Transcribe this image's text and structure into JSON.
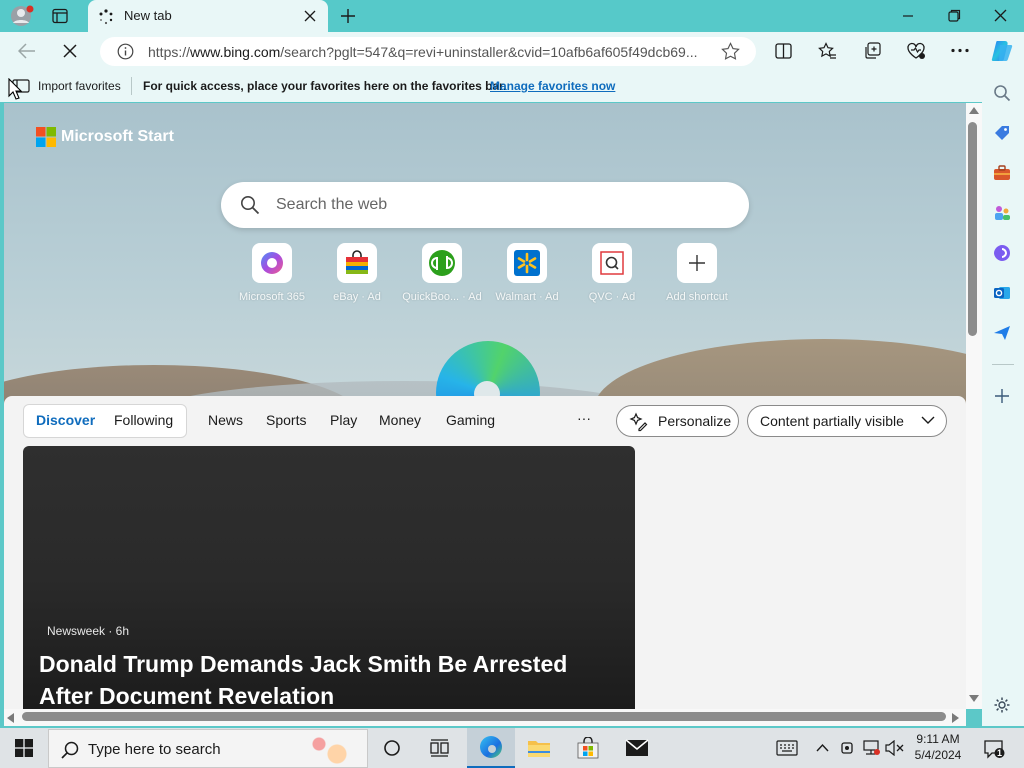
{
  "browser": {
    "tab_title": "New tab",
    "url_prefix": "https://",
    "url_host": "www.bing.com",
    "url_rest": "/search?pglt=547&q=revi+uninstaller&cvid=10afb6af605f49dcb69...",
    "favorites_bar": {
      "import_label": "Import favorites",
      "hint": "For quick access, place your favorites here on the favorites bar.",
      "manage_link": "Manage favorites now"
    }
  },
  "page": {
    "brand": "Microsoft Start",
    "search_placeholder": "Search the web",
    "shortcuts": [
      {
        "label": "Microsoft 365"
      },
      {
        "label": "eBay · Ad"
      },
      {
        "label": "QuickBoo... · Ad"
      },
      {
        "label": "Walmart · Ad"
      },
      {
        "label": "QVC · Ad"
      },
      {
        "label": "Add shortcut"
      }
    ],
    "pivots": {
      "discover": "Discover",
      "following": "Following",
      "news": "News",
      "sports": "Sports",
      "play": "Play",
      "money": "Money",
      "gaming": "Gaming",
      "more": "···"
    },
    "personalize_label": "Personalize",
    "content_visibility": "Content partially visible",
    "card": {
      "source": "Newsweek · 6h",
      "headline": "Donald Trump Demands Jack Smith Be Arrested After Document Revelation"
    }
  },
  "taskbar": {
    "search_placeholder": "Type here to search",
    "time": "9:11 AM",
    "date": "5/4/2024",
    "notification_count": "1"
  },
  "colors": {
    "accent": "#0f6cbd",
    "frame": "#56c9c9"
  }
}
